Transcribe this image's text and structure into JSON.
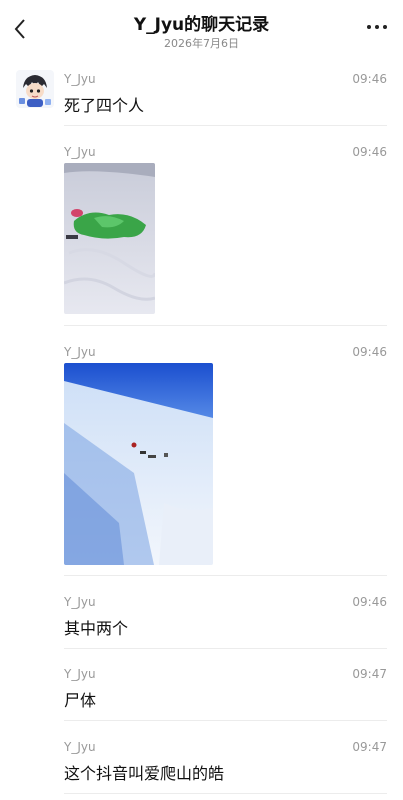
{
  "header": {
    "title": "Y_Jyu的聊天记录",
    "date": "2026年7月6日"
  },
  "messages": [
    {
      "sender": "Y_Jyu",
      "time": "09:46",
      "text": "死了四个人"
    },
    {
      "sender": "Y_Jyu",
      "time": "09:46",
      "image": "snow-photo-green-tarp"
    },
    {
      "sender": "Y_Jyu",
      "time": "09:46",
      "image": "snow-photo-blue-sky"
    },
    {
      "sender": "Y_Jyu",
      "time": "09:46",
      "text": "其中两个"
    },
    {
      "sender": "Y_Jyu",
      "time": "09:47",
      "text": "尸体"
    },
    {
      "sender": "Y_Jyu",
      "time": "09:47",
      "text": "这个抖音叫爱爬山的皓"
    }
  ]
}
